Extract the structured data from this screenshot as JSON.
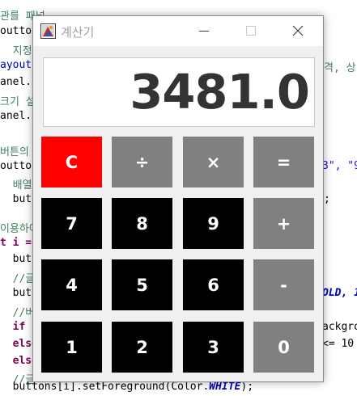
{
  "window": {
    "title": "계산기",
    "controls": {
      "minimize": "minimize",
      "maximize": "maximize",
      "close": "close"
    }
  },
  "display": {
    "value": "3481.0"
  },
  "keys": {
    "clear": "C",
    "divide": "÷",
    "multiply": "×",
    "equals": "=",
    "seven": "7",
    "eight": "8",
    "nine": "9",
    "plus": "+",
    "four": "4",
    "five": "5",
    "six": "6",
    "minus": "-",
    "one": "1",
    "two": "2",
    "three": "3",
    "zero": "0"
  },
  "colors": {
    "clear": "#ff0000",
    "operator": "#808080",
    "digit": "#000000",
    "key_text": "#ffffff",
    "display_text": "#333333"
  },
  "code": {
    "l01": "관를 패널",
    "l02": "outto",
    "l03": "  지정",
    "l04": "ayout",
    "l04r": "격, 상",
    "l05": "anel.",
    "l06": "크기 설",
    "l07": "anel.",
    "l08": "버튼의",
    "l09": "outto",
    "l09r": "3\", \"9",
    "l10": "  배열",
    "l11": "  butt",
    "l11r": ";",
    "l12": "이용하여",
    "l13": "t i =",
    "l14": "  butt",
    "l15": "  //글",
    "l16": "  butt",
    "l16r": "OLD, 1",
    "l17": "  //버",
    "l18": "  if (",
    "l18r": "ackgro",
    "l19": "  else",
    "l19r": "<= 10",
    "l20": "  else",
    "l21": "  //글",
    "l22": "  buttons[i].setForeground(Color.",
    "l22c": "WHITE",
    "l22e": ");"
  }
}
